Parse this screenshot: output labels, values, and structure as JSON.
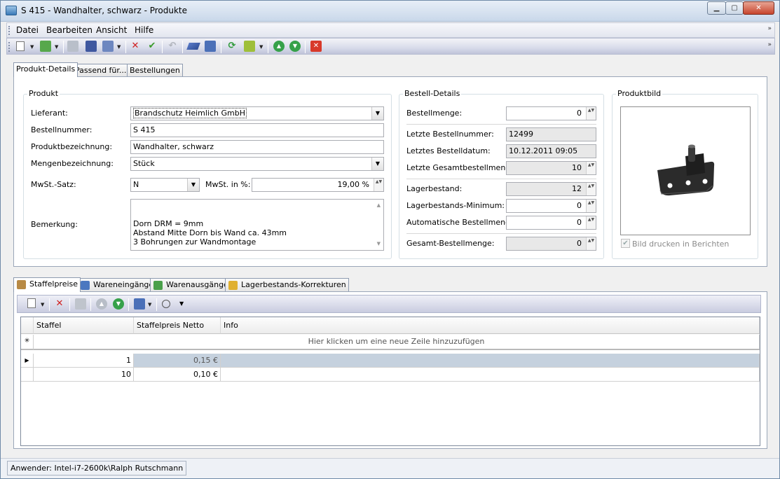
{
  "window": {
    "title": "S 415 - Wandhalter, schwarz - Produkte",
    "min_glyph": "▁",
    "max_glyph": "▢",
    "close_glyph": "✕"
  },
  "menu": {
    "items": [
      "Datei",
      "Bearbeiten",
      "Ansicht",
      "Hilfe"
    ]
  },
  "tabs": [
    "Produkt-Details",
    "Passend für...",
    "Bestellungen"
  ],
  "produkt": {
    "title": "Produkt",
    "lieferant_label": "Lieferant:",
    "lieferant_value": "Brandschutz Heimlich GmbH",
    "bestellnummer_label": "Bestellnummer:",
    "bestellnummer_value": "S 415",
    "produktbezeichnung_label": "Produktbezeichnung:",
    "produktbezeichnung_value": "Wandhalter, schwarz",
    "mengenbezeichnung_label": "Mengenbezeichnung:",
    "mengenbezeichnung_value": "Stück",
    "mwst_satz_label": "MwSt.-Satz:",
    "mwst_satz_value": "N",
    "mwst_prozent_label": "MwSt. in %:",
    "mwst_prozent_value": "19,00 %",
    "bemerkung_label": "Bemerkung:",
    "bemerkung_lines": [
      "Dorn DRM = 9mm",
      "Abstand Mitte Dorn bis Wand ca. 43mm",
      "3 Bohrungen zur Wandmontage"
    ]
  },
  "bestell": {
    "title": "Bestell-Details",
    "bestellmenge_label": "Bestellmenge:",
    "bestellmenge_value": "0",
    "letzte_nr_label": "Letzte Bestellnummer:",
    "letzte_nr_value": "12499",
    "letztes_datum_label": "Letztes Bestelldatum:",
    "letztes_datum_value": "10.12.2011 09:05",
    "letzte_gesamt_label": "Letzte Gesamtbestellmenge:",
    "letzte_gesamt_value": "10",
    "lagerbestand_label": "Lagerbestand:",
    "lagerbestand_value": "12",
    "lager_min_label": "Lagerbestands-Minimum:",
    "lager_min_value": "0",
    "auto_label": "Automatische Bestellmenge:",
    "auto_value": "0",
    "gesamt_label": "Gesamt-Bestellmenge:",
    "gesamt_value": "0"
  },
  "bild": {
    "title": "Produktbild",
    "checkbox_label": "Bild drucken in Berichten",
    "checked": true
  },
  "lower_tabs": [
    "Staffelpreise",
    "Wareneingänge",
    "Warenausgänge",
    "Lagerbestands-Korrekturen"
  ],
  "grid": {
    "columns": [
      "Staffel",
      "Staffelpreis Netto",
      "Info"
    ],
    "new_row_text": "Hier klicken um eine neue Zeile hinzuzufügen",
    "new_row_marker": "✳",
    "current_marker": "▶",
    "rows": [
      {
        "staffel": "1",
        "preis": "0,15 €",
        "info": ""
      },
      {
        "staffel": "10",
        "preis": "0,10 €",
        "info": ""
      }
    ]
  },
  "status": {
    "text": "Anwender: Intel-i7-2600k\\Ralph Rutschmann"
  },
  "icons": {
    "dropdown": "▼",
    "spin": "▲▼",
    "scroll_up": "▲",
    "scroll_down": "▼",
    "check": "✔",
    "cross": "✕",
    "arrow_up": "▲",
    "arrow_down": "▼",
    "grip_right": "»"
  },
  "colors": {
    "selected_row": "#c5d1de",
    "titlebar": "#dbe5f1",
    "close_button": "#c7452d"
  }
}
